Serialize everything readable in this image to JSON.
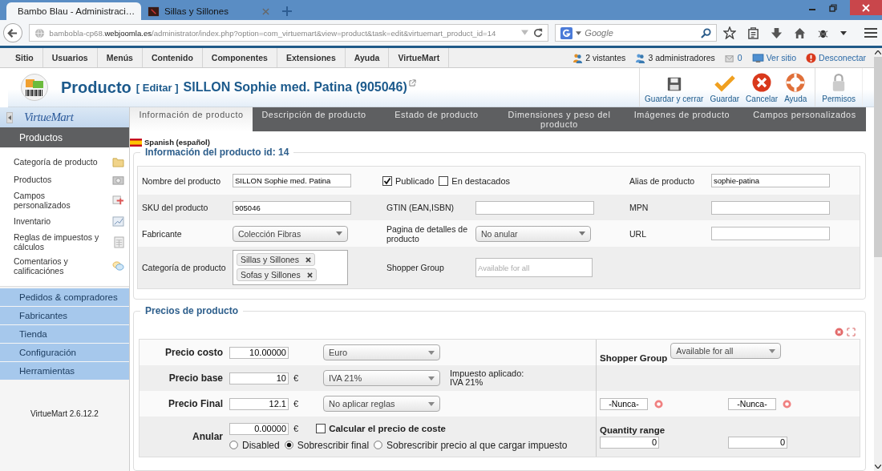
{
  "browser": {
    "tabs": [
      {
        "title": "Bambo Blau - Administraci…",
        "selected": true
      },
      {
        "title": "Sillas y Sillones",
        "selected": false
      }
    ],
    "url": "bambobla-cp68.**webjoomla.es**/administrator/index.php?option=com_virtuemart&view=product&task=edit&virtuemart_product_id=14",
    "search": {
      "placeholder": "Google"
    }
  },
  "menu": {
    "items": [
      "Sitio",
      "Usuarios",
      "Menús",
      "Contenido",
      "Componentes",
      "Extensiones",
      "Ayuda",
      "VirtueMart"
    ],
    "status": [
      {
        "kind": "visitors",
        "label": "2 vistantes"
      },
      {
        "kind": "admins",
        "label": "3 administradores"
      },
      {
        "kind": "messages",
        "label": "0"
      },
      {
        "kind": "site",
        "label": "Ver sitio"
      },
      {
        "kind": "logout",
        "label": "Desconectar"
      }
    ]
  },
  "header": {
    "title": "Producto",
    "edit": "[ Editar ]",
    "product": "SILLON Sophie med. Patina (905046)",
    "toolbar": [
      {
        "kind": "save-close",
        "label": "Guardar y cerrar"
      },
      {
        "kind": "save",
        "label": "Guardar"
      },
      {
        "kind": "cancel",
        "label": "Cancelar"
      },
      {
        "kind": "help",
        "label": "Ayuda"
      },
      {
        "kind": "permissions",
        "label": "Permisos"
      }
    ]
  },
  "sidebar": {
    "logo": "VirtueMart",
    "sections": [
      {
        "label": "Productos",
        "expanded": true,
        "items": [
          {
            "kind": "category",
            "label": "Categoría de producto"
          },
          {
            "kind": "products",
            "label": "Productos"
          },
          {
            "kind": "custom",
            "label": "Campos personalizados"
          },
          {
            "kind": "inventory",
            "label": "Inventario"
          },
          {
            "kind": "taxes",
            "label": "Reglas de impuestos y cálculos"
          },
          {
            "kind": "reviews",
            "label": "Comentarios y calificaciónes"
          }
        ]
      },
      {
        "label": "Pedidos & compradores",
        "expanded": false
      },
      {
        "label": "Fabricantes",
        "expanded": false
      },
      {
        "label": "Tienda",
        "expanded": false
      },
      {
        "label": "Configuración",
        "expanded": false
      },
      {
        "label": "Herramientas",
        "expanded": false
      }
    ],
    "version": "VirtueMart 2.6.12.2"
  },
  "tabs": [
    {
      "label": "Información de producto",
      "selected": true
    },
    {
      "label": "Descripción de producto",
      "selected": false
    },
    {
      "label": "Estado de producto",
      "selected": false
    },
    {
      "label": "Dimensiones y peso del producto",
      "selected": false
    },
    {
      "label": "Imágenes de producto",
      "selected": false
    },
    {
      "label": "Campos personalizados",
      "selected": false
    }
  ],
  "language": "Spanish (español)",
  "info": {
    "legend": "Información del producto id: 14",
    "rows": [
      {
        "cells": [
          {
            "kind": "label",
            "text": "Nombre del producto"
          },
          {
            "kind": "input",
            "value": "SILLON Sophie med. Patina"
          },
          {
            "kind": "checks",
            "items": [
              {
                "label": "Publicado",
                "checked": true
              },
              {
                "label": "En destacados",
                "checked": false
              }
            ]
          },
          {
            "kind": "empty"
          },
          {
            "kind": "label",
            "text": "Alias de producto"
          },
          {
            "kind": "input",
            "value": "sophie-patina"
          }
        ]
      },
      {
        "cells": [
          {
            "kind": "label",
            "text": "SKU del producto"
          },
          {
            "kind": "input",
            "value": "905046"
          },
          {
            "kind": "label",
            "text": "GTIN (EAN,ISBN)"
          },
          {
            "kind": "input"
          },
          {
            "kind": "label",
            "text": "MPN"
          },
          {
            "kind": "input"
          }
        ]
      },
      {
        "cells": [
          {
            "kind": "label",
            "text": "Fabricante"
          },
          {
            "kind": "select",
            "value": "Colección Fibras"
          },
          {
            "kind": "label",
            "text": "Pagina de detalles de producto"
          },
          {
            "kind": "select",
            "value": "No anular"
          },
          {
            "kind": "label",
            "text": "URL"
          },
          {
            "kind": "input"
          }
        ]
      },
      {
        "cells": [
          {
            "kind": "label",
            "text": "Categoría de producto"
          },
          {
            "kind": "tags",
            "items": [
              "Sillas y Sillones",
              "Sofas y Sillones"
            ]
          },
          {
            "kind": "label",
            "text": "Shopper Group"
          },
          {
            "kind": "input",
            "placeholder": "Available for all"
          }
        ]
      }
    ]
  },
  "prices": {
    "legend": "Precios de producto",
    "rows": [
      {
        "label": "Precio costo",
        "value": "10.00000",
        "select": "Euro"
      },
      {
        "label": "Precio base",
        "value": "10",
        "currency": "€",
        "select": "IVA 21%",
        "note": [
          "Impuesto aplicado:",
          "IVA 21%"
        ]
      },
      {
        "label": "Precio Final",
        "value": "12.1",
        "currency": "€",
        "select": "No aplicar reglas"
      }
    ],
    "override": {
      "label": "Anular",
      "value": "0.00000",
      "currency": "€",
      "calculate": {
        "label": "Calcular el precio de coste",
        "checked": false
      },
      "modes": [
        {
          "label": "Disabled",
          "selected": false
        },
        {
          "label": "Sobrescribir final",
          "selected": true
        },
        {
          "label": "Sobrescribir precio al que cargar impuesto",
          "selected": false
        }
      ]
    },
    "shopper_group": {
      "label": "Shopper Group",
      "value": "Available for all"
    },
    "dates": [
      "-Nunca-",
      "-Nunca-"
    ],
    "quantity": {
      "label": "Quantity range",
      "values": [
        "0",
        "0"
      ]
    }
  }
}
